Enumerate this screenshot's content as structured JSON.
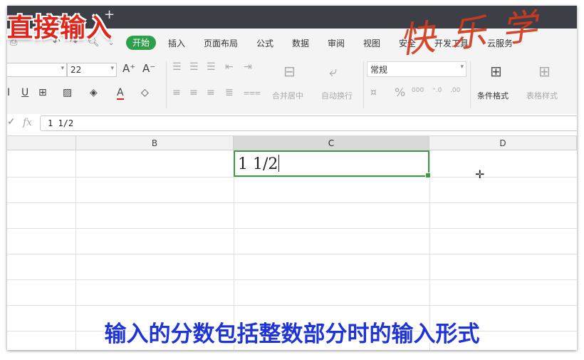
{
  "overlay": {
    "title": "直接输入",
    "brand": "快乐学",
    "subtitle": "输入的分数包括整数部分时的输入形式"
  },
  "ribbon": {
    "new_tab": "+",
    "start": "开始",
    "tabs": [
      "插入",
      "页面布局",
      "公式",
      "数据",
      "审阅",
      "视图",
      "安全",
      "开发工具",
      "云服务"
    ]
  },
  "toolbar": {
    "font_size": "22",
    "number_format": "常规",
    "merge_center": "合并居中",
    "auto_wrap": "自动换行",
    "conditional_format": "条件格式",
    "table_style": "表格样式"
  },
  "formula_bar": {
    "fx": "fx",
    "value": "1 1/2"
  },
  "columns": [
    "B",
    "C",
    "D"
  ],
  "active_cell": {
    "column": "C",
    "value": "1  1/2"
  }
}
